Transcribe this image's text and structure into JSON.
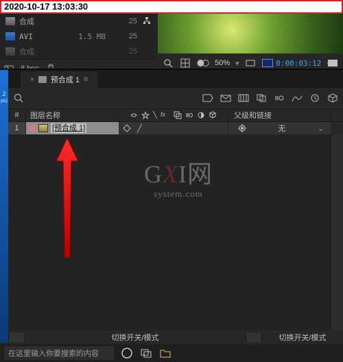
{
  "timestamp": "2020-10-17 13:03:30",
  "project": {
    "assets": [
      {
        "name": "合成",
        "rate": "25",
        "size": "",
        "type": "comp"
      },
      {
        "name": "AVI",
        "rate": "25",
        "size": "1.5 MB",
        "type": "avi"
      },
      {
        "name": "合成",
        "rate": "25",
        "size": "",
        "type": "comp"
      }
    ],
    "bpc": "8 bpc"
  },
  "preview": {
    "zoom": "50%",
    "timecode": "0:00:03:12"
  },
  "timeline": {
    "tab_label": "预合成 1",
    "columns": {
      "num": "#",
      "layer_name": "图层名称",
      "parent": "父级和链接"
    },
    "row": {
      "index": "1",
      "name": "[预合成 1]",
      "parent_value": "无"
    },
    "footer_toggle": "切换开关/模式"
  },
  "taskbar": {
    "search_placeholder": "在这里输入你要搜索的内容"
  },
  "watermark": {
    "line1_a": "G",
    "line1_b": "X",
    "line1_c": "I网",
    "line2": "system.com"
  }
}
